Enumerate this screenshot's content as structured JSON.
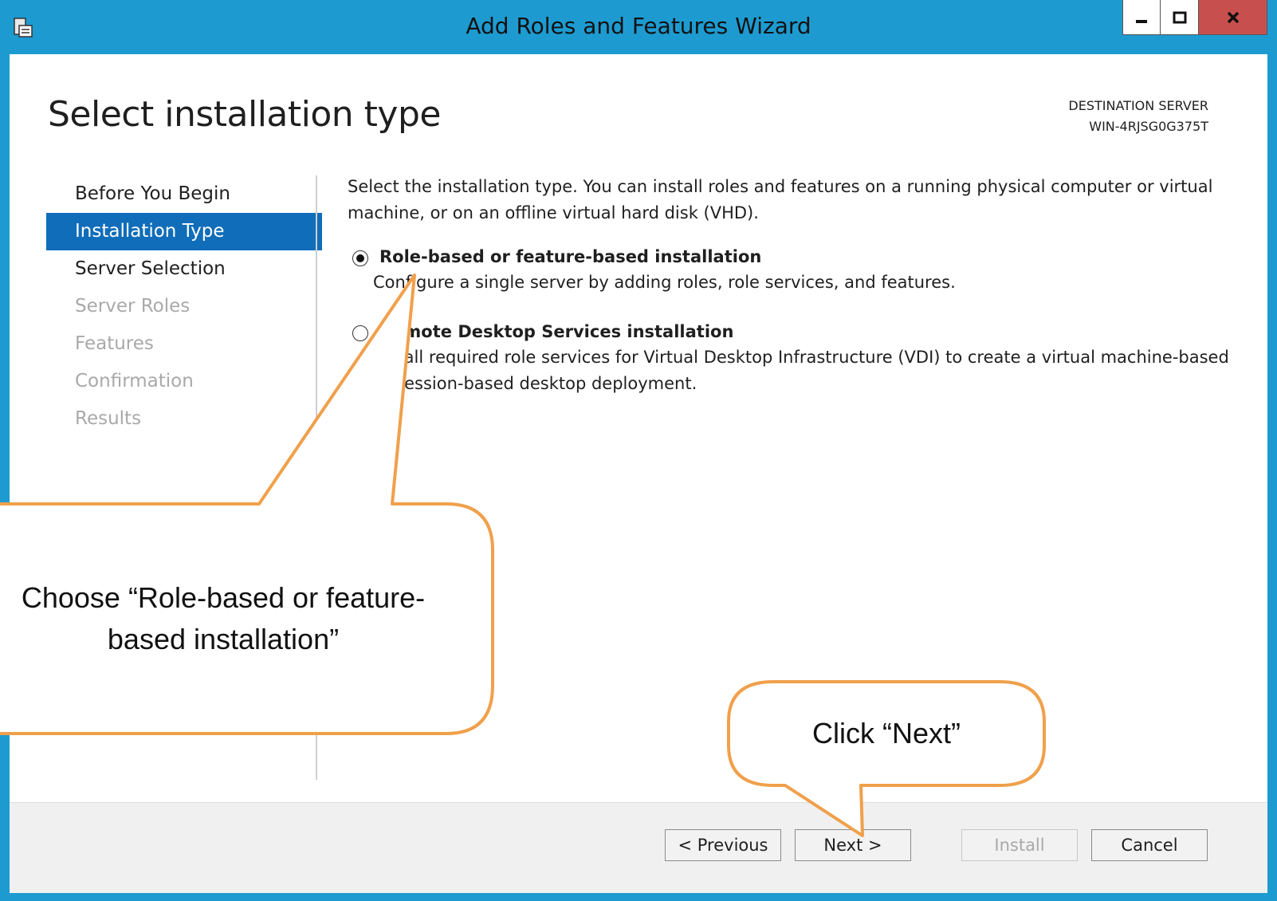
{
  "window": {
    "title": "Add Roles and Features Wizard",
    "app_icon": "server-manager-icon",
    "controls": {
      "minimize": "minimize-icon",
      "maximize": "maximize-icon",
      "close": "close-icon"
    }
  },
  "header": {
    "page_title": "Select installation type",
    "destination_label": "DESTINATION SERVER",
    "destination_server": "WIN-4RJSG0G375T"
  },
  "nav": {
    "items": [
      {
        "label": "Before You Begin",
        "state": "normal"
      },
      {
        "label": "Installation Type",
        "state": "active"
      },
      {
        "label": "Server Selection",
        "state": "normal"
      },
      {
        "label": "Server Roles",
        "state": "disabled"
      },
      {
        "label": "Features",
        "state": "disabled"
      },
      {
        "label": "Confirmation",
        "state": "disabled"
      },
      {
        "label": "Results",
        "state": "disabled"
      }
    ]
  },
  "main": {
    "description_line1": "Select the installation type. You can install roles and features on a running physical computer or virtual",
    "description_line2": "machine, or on an offline virtual hard disk (VHD).",
    "options": [
      {
        "label": "Role-based or feature-based installation",
        "selected": true,
        "desc_lines": [
          "Configure a single server by adding roles, role services, and features."
        ]
      },
      {
        "label": "Remote Desktop Services installation",
        "selected": false,
        "desc_lines": [
          "Install required role services for Virtual Desktop Infrastructure (VDI) to create a virtual machine-based",
          "or session-based desktop deployment."
        ]
      }
    ]
  },
  "footer": {
    "previous": "< Previous",
    "next": "Next >",
    "install": "Install",
    "cancel": "Cancel"
  },
  "callouts": {
    "role_line1": "Choose “Role-based or feature-",
    "role_line2": "based installation”",
    "next": "Click “Next”"
  },
  "colors": {
    "frame": "#1d9bd1",
    "nav_active": "#0f6db9",
    "close_button": "#c7504f",
    "callout_border": "#f0a04b"
  }
}
